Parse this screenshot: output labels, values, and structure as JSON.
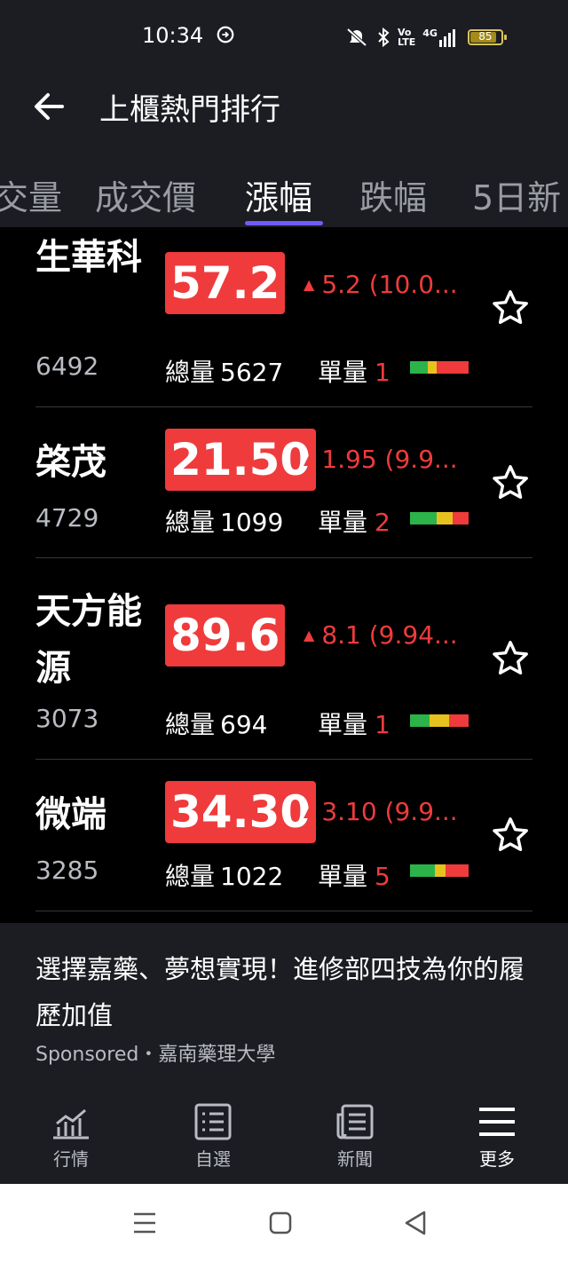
{
  "status": {
    "time": "10:34",
    "battery": "85",
    "network": "4G"
  },
  "header": {
    "title": "上櫃熱門排行"
  },
  "tabs": [
    "交量",
    "成交價",
    "漲幅",
    "跌幅",
    "5日新"
  ],
  "colors": {
    "up": "#ef3b3b",
    "accent": "#6f5bff",
    "header_bg": "#1b1d22"
  },
  "labels": {
    "total_volume": "總量",
    "single_volume": "單量"
  },
  "stocks": [
    {
      "name": "生華科",
      "code": "6492",
      "price": "57.2",
      "change": "5.2 (10.0...",
      "total_volume": "5627",
      "single_volume": "1"
    },
    {
      "name": "棨茂",
      "code": "4729",
      "price": "21.50",
      "change": "1.95 (9.9...",
      "total_volume": "1099",
      "single_volume": "2"
    },
    {
      "name": "天方能源",
      "code": "3073",
      "price": "89.6",
      "change": "8.1 (9.94...",
      "total_volume": "694",
      "single_volume": "1"
    },
    {
      "name": "微端",
      "code": "3285",
      "price": "34.30",
      "change": "3.10 (9.9...",
      "total_volume": "1022",
      "single_volume": "5"
    }
  ],
  "ad": {
    "text": "選擇嘉藥、夢想實現！進修部四技為你的履歷加值",
    "sponsor": "Sponsored・嘉南藥理大學"
  },
  "bottom_nav": [
    {
      "label": "行情",
      "icon": "chart-icon"
    },
    {
      "label": "自選",
      "icon": "list-icon"
    },
    {
      "label": "新聞",
      "icon": "news-icon"
    },
    {
      "label": "更多",
      "icon": "menu-icon"
    }
  ]
}
